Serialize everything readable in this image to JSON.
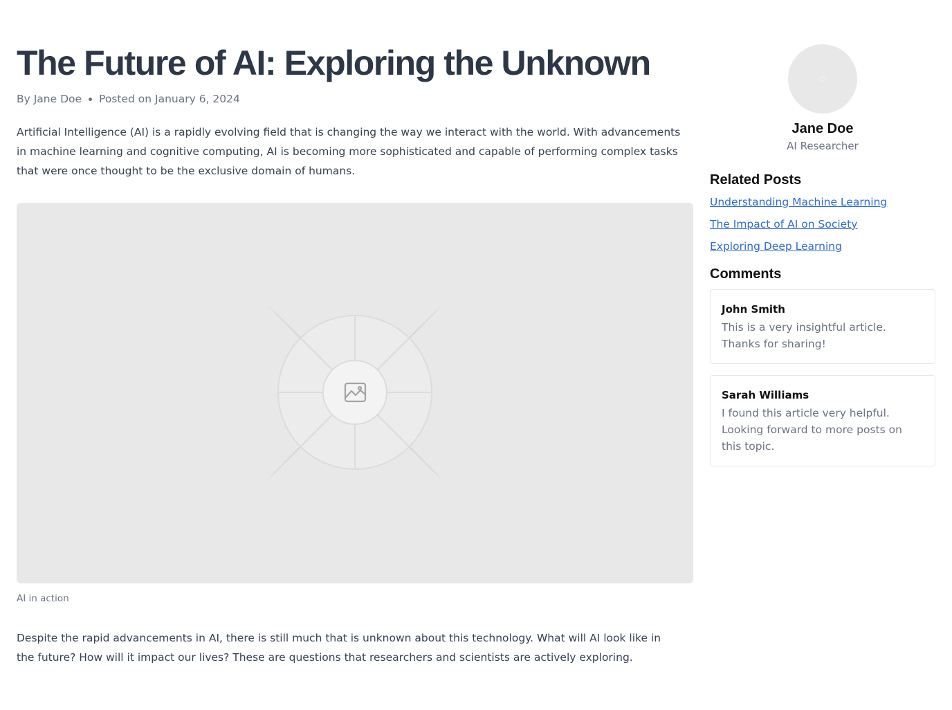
{
  "article": {
    "title": "The Future of AI: Exploring the Unknown",
    "byline": "By Jane Doe",
    "posted": "Posted on January 6, 2024",
    "intro": "Artificial Intelligence (AI) is a rapidly evolving field that is changing the way we interact with the world. With advancements in machine learning and cognitive computing, AI is becoming more sophisticated and capable of performing complex tasks that were once thought to be the exclusive domain of humans.",
    "image_caption": "AI in action",
    "body": "Despite the rapid advancements in AI, there is still much that is unknown about this technology. What will AI look like in the future? How will it impact our lives? These are questions that researchers and scientists are actively exploring."
  },
  "sidebar": {
    "author": {
      "name": "Jane Doe",
      "role": "AI Researcher"
    },
    "related": {
      "heading": "Related Posts",
      "items": [
        {
          "label": "Understanding Machine Learning"
        },
        {
          "label": "The Impact of AI on Society"
        },
        {
          "label": "Exploring Deep Learning"
        }
      ]
    },
    "comments": {
      "heading": "Comments",
      "items": [
        {
          "author": "John Smith",
          "text": "This is a very insightful article. Thanks for sharing!"
        },
        {
          "author": "Sarah Williams",
          "text": "I found this article very helpful. Looking forward to more posts on this topic."
        }
      ]
    }
  },
  "icons": {
    "image_placeholder": "image-placeholder-icon",
    "avatar": "avatar-placeholder-icon"
  },
  "colors": {
    "title": "#2e3747",
    "link": "#2f6bd6",
    "muted": "#6b7280",
    "placeholder_bg": "#e8e8e8"
  }
}
